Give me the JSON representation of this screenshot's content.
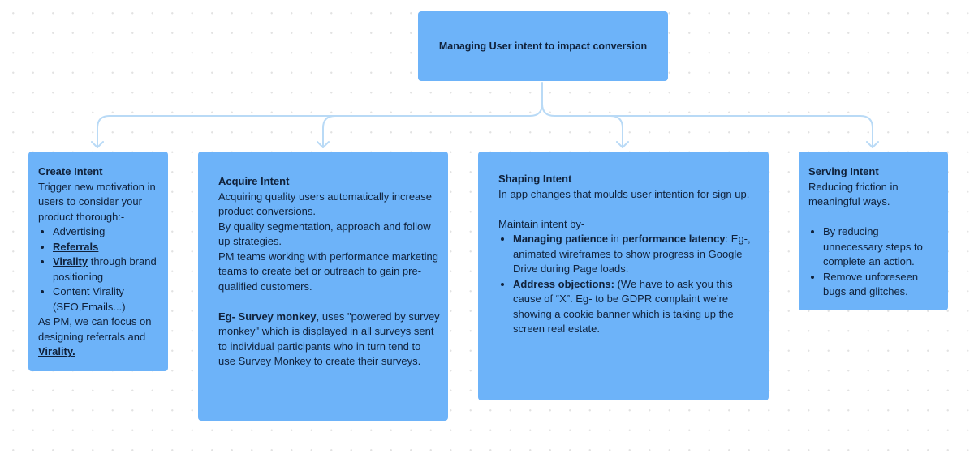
{
  "diagram": {
    "root": {
      "title": "Managing User intent to impact conversion"
    },
    "nodes": [
      {
        "id": "create",
        "title": "Create Intent",
        "intro": "Trigger new motivation in users to consider your product thorough:-",
        "bullets": [
          {
            "bold": "",
            "underline": "",
            "text": "Advertising"
          },
          {
            "bold": "",
            "underline": "Referrals",
            "text": ""
          },
          {
            "bold": "",
            "underline": "Virality",
            "text": " through brand positioning"
          },
          {
            "bold": "",
            "underline": "",
            "text": "Content Virality (SEO,Emails...)"
          }
        ],
        "outro": "As PM, we can focus on designing referrals and ",
        "outro_emphasis": "Virality."
      },
      {
        "id": "acquire",
        "title": "Acquire Intent",
        "paragraphs": [
          "Acquiring quality users automatically increase product conversions.",
          "By quality segmentation, approach and follow up strategies.",
          "PM teams working with performance marketing teams to create bet or outreach to gain pre-qualified customers."
        ],
        "example_bold": "Eg- Survey monkey",
        "example_text": ", uses \"powered by survey monkey\" which is displayed in all surveys sent to individual participants who in turn tend to use Survey Monkey to create their surveys."
      },
      {
        "id": "shaping",
        "title": "Shaping Intent",
        "intro": "In app changes that moulds user intention for sign up.",
        "lead": "Maintain intent by-",
        "bullets": [
          {
            "bold1": "Managing patience",
            "mid": " in ",
            "bold2": "performance latency",
            "text": ": Eg-, animated wireframes to show progress in Google Drive during Page loads."
          },
          {
            "bold1": "Address objections:",
            "mid": "",
            "bold2": "",
            "text": " (We have to ask you this cause of “X”. Eg- to be GDPR complaint we’re showing a cookie banner which is taking up the screen real estate."
          }
        ]
      },
      {
        "id": "serving",
        "title": "Serving Intent",
        "intro": "Reducing friction in meaningful ways.",
        "bullets": [
          "By reducing unnecessary steps to complete an action.",
          "Remove unforeseen bugs and glitches."
        ]
      }
    ],
    "colors": {
      "box_fill": "#6db3f9",
      "connector": "#b9daf6",
      "text": "#10213a"
    }
  }
}
